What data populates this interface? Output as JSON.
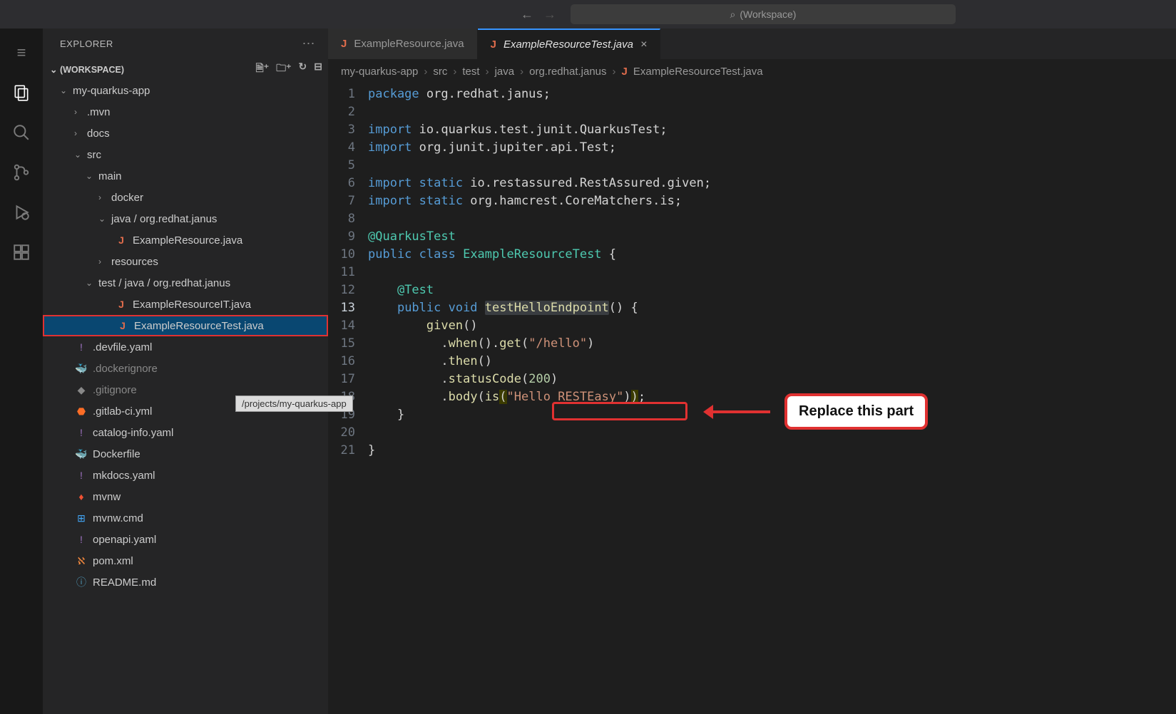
{
  "titlebar": {
    "search_placeholder": "(Workspace)"
  },
  "sidebar": {
    "title": "EXPLORER",
    "workspace": "(WORKSPACE)",
    "tooltip": "/projects/my-quarkus-app"
  },
  "tree": {
    "root": "my-quarkus-app",
    "mvn": ".mvn",
    "docs": "docs",
    "src": "src",
    "main": "main",
    "docker": "docker",
    "java_pkg": "java / org.redhat.janus",
    "example_resource": "ExampleResource.java",
    "resources": "resources",
    "test_pkg": "test / java / org.redhat.janus",
    "example_it": "ExampleResourceIT.java",
    "example_test": "ExampleResourceTest.java",
    "devfile": ".devfile.yaml",
    "dockerignore": ".dockerignore",
    "gitignore": ".gitignore",
    "gitlab": ".gitlab-ci.yml",
    "catalog": "catalog-info.yaml",
    "dockerfile": "Dockerfile",
    "mkdocs": "mkdocs.yaml",
    "mvnw": "mvnw",
    "mvnw_cmd": "mvnw.cmd",
    "openapi": "openapi.yaml",
    "pom": "pom.xml",
    "readme": "README.md"
  },
  "tabs": {
    "inactive": "ExampleResource.java",
    "active": "ExampleResourceTest.java"
  },
  "breadcrumbs": [
    "my-quarkus-app",
    "src",
    "test",
    "java",
    "org.redhat.janus",
    "ExampleResourceTest.java"
  ],
  "code": {
    "l1": {
      "kw": "package",
      "rest": " org.redhat.janus;"
    },
    "l3": {
      "kw": "import",
      "rest": " io.quarkus.test.junit.QuarkusTest;"
    },
    "l4": {
      "kw": "import",
      "rest": " org.junit.jupiter.api.Test;"
    },
    "l6": {
      "kw": "import static",
      "rest": " io.restassured.RestAssured.given;"
    },
    "l7": {
      "kw": "import static",
      "rest": " org.hamcrest.CoreMatchers.is;"
    },
    "l9": "@QuarkusTest",
    "l10_kw": "public class",
    "l10_cls": "ExampleResourceTest",
    "l12": "@Test",
    "l13_kw": "public void",
    "l13_fn": "testHelloEndpoint",
    "l14_fn": "given",
    "l15_when": "when",
    "l15_get": "get",
    "l15_str": "\"/hello\"",
    "l16_then": "then",
    "l17_sc": "statusCode",
    "l17_num": "200",
    "l18_body": "body",
    "l18_is": "is",
    "l18_str": "\"Hello RESTEasy\""
  },
  "callout": "Replace this part"
}
